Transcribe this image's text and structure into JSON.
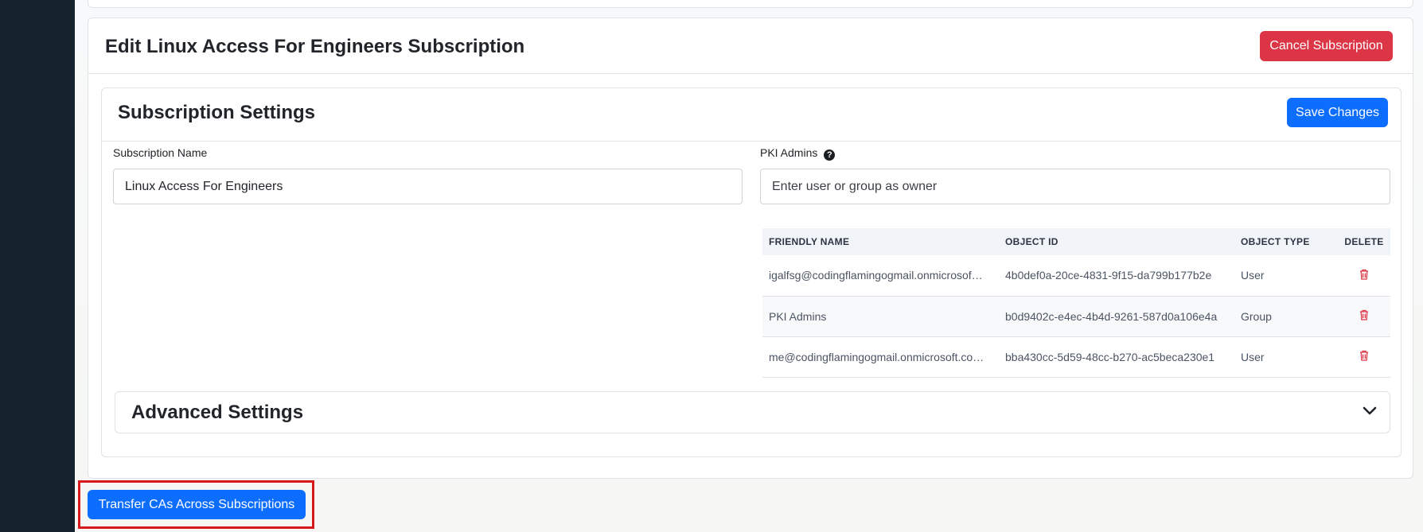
{
  "edit_card": {
    "title": "Edit Linux Access For Engineers Subscription",
    "cancel_label": "Cancel Subscription"
  },
  "settings": {
    "title": "Subscription Settings",
    "save_label": "Save Changes",
    "subscription_name_label": "Subscription Name",
    "subscription_name_value": "Linux Access For Engineers",
    "pki_admins_label": "PKI Admins",
    "pki_admins_placeholder": "Enter user or group as owner"
  },
  "admins_table": {
    "headers": [
      "FRIENDLY NAME",
      "OBJECT ID",
      "OBJECT TYPE",
      "DELETE"
    ],
    "rows": [
      {
        "friendly_name": "igalfsg@codingflamingogmail.onmicrosof…",
        "object_id": "4b0def0a-20ce-4831-9f15-da799b177b2e",
        "object_type": "User"
      },
      {
        "friendly_name": "PKI Admins",
        "object_id": "b0d9402c-e4ec-4b4d-9261-587d0a106e4a",
        "object_type": "Group"
      },
      {
        "friendly_name": "me@codingflamingogmail.onmicrosoft.co…",
        "object_id": "bba430cc-5d59-48cc-b270-ac5beca230e1",
        "object_type": "User"
      }
    ]
  },
  "advanced": {
    "title": "Advanced Settings"
  },
  "footer": {
    "transfer_label": "Transfer CAs Across Subscriptions"
  },
  "colors": {
    "sidebar": "#17222f",
    "primary": "#0d6efd",
    "danger": "#dc3545",
    "highlight": "#d7191c"
  },
  "icons": {
    "help": "question-circle-icon",
    "delete": "trash-icon",
    "expand": "chevron-down-icon"
  }
}
